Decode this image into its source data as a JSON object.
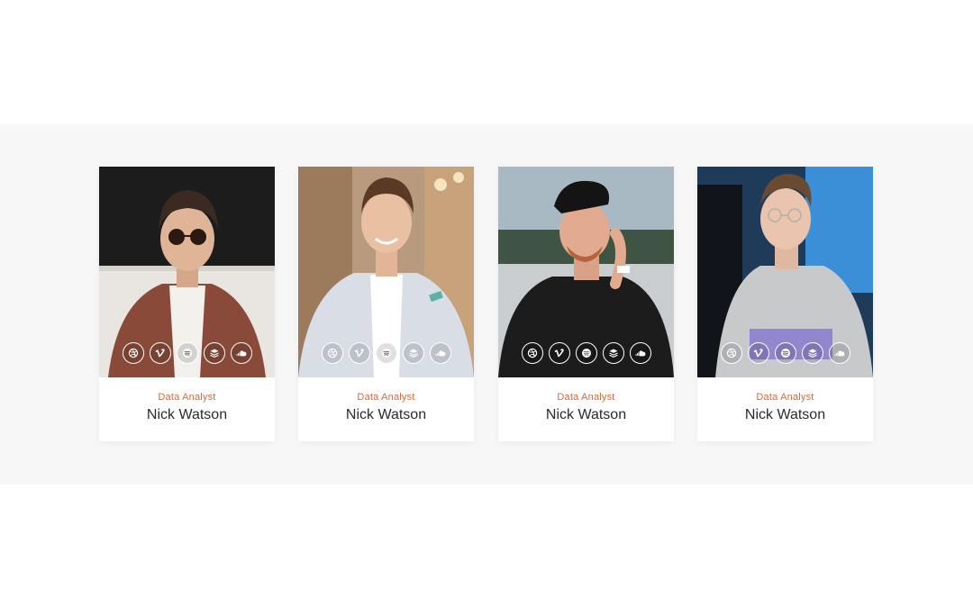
{
  "accent_color": "#d46a3a",
  "members": [
    {
      "role": "Data Analyst",
      "name": "Nick Watson",
      "socials": [
        "dribbble-icon",
        "vimeo-icon",
        "spotify-icon",
        "buffer-icon",
        "soundcloud-icon"
      ]
    },
    {
      "role": "Data Analyst",
      "name": "Nick Watson",
      "socials": [
        "dribbble-icon",
        "vimeo-icon",
        "spotify-icon",
        "buffer-icon",
        "soundcloud-icon"
      ]
    },
    {
      "role": "Data Analyst",
      "name": "Nick Watson",
      "socials": [
        "dribbble-icon",
        "vimeo-icon",
        "spotify-icon",
        "buffer-icon",
        "soundcloud-icon"
      ]
    },
    {
      "role": "Data Analyst",
      "name": "Nick Watson",
      "socials": [
        "dribbble-icon",
        "vimeo-icon",
        "spotify-icon",
        "buffer-icon",
        "soundcloud-icon"
      ]
    }
  ]
}
